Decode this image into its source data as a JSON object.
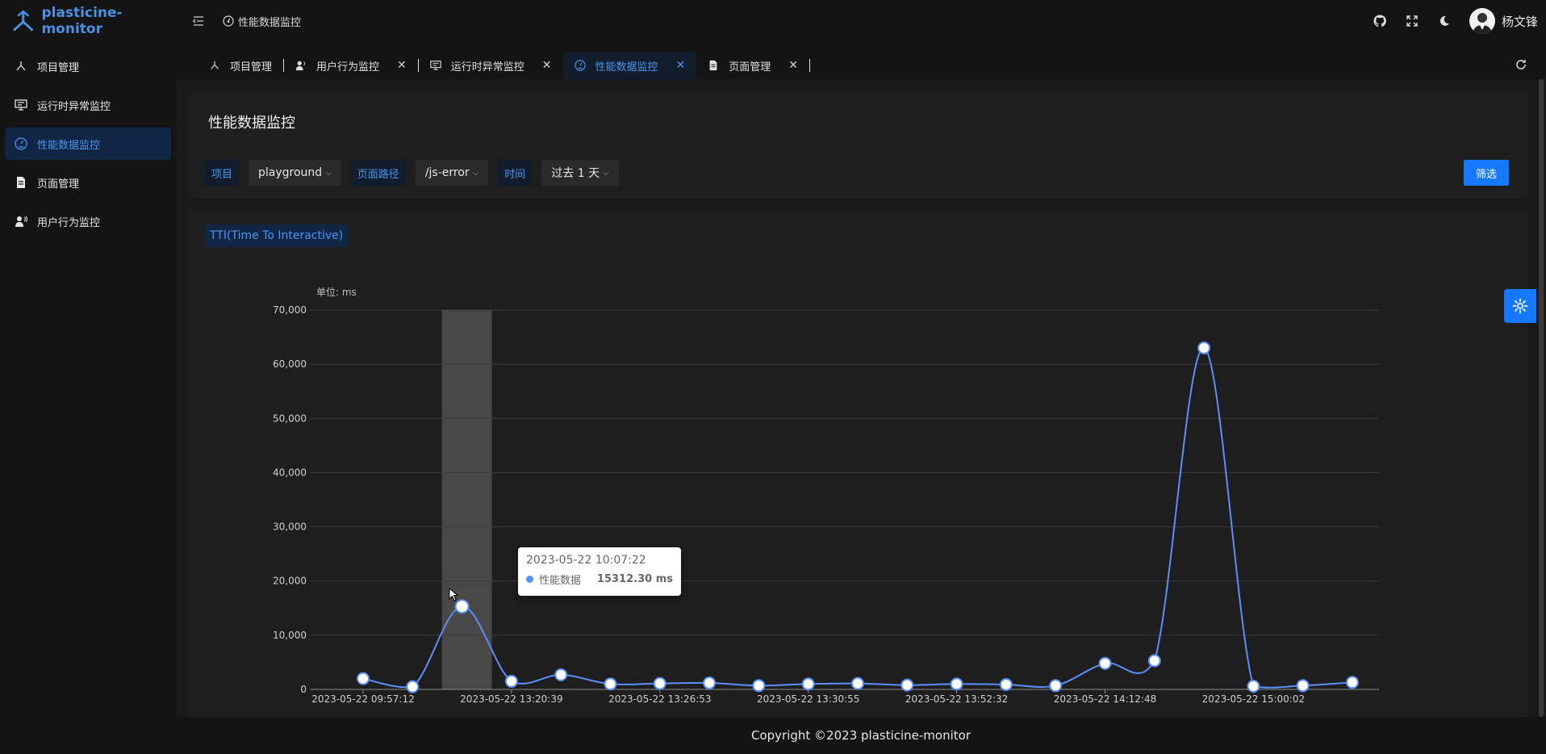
{
  "app": {
    "name": "plasticine-monitor"
  },
  "header": {
    "breadcrumb": "性能数据监控",
    "user_name": "杨文锋",
    "icons": [
      "github-icon",
      "fullscreen-icon",
      "dark-mode-icon"
    ]
  },
  "sidebar": {
    "items": [
      {
        "label": "项目管理",
        "icon": "project-icon",
        "active": false
      },
      {
        "label": "运行时异常监控",
        "icon": "monitor-icon",
        "active": false
      },
      {
        "label": "性能数据监控",
        "icon": "performance-icon",
        "active": true
      },
      {
        "label": "页面管理",
        "icon": "page-icon",
        "active": false
      },
      {
        "label": "用户行为监控",
        "icon": "user-behavior-icon",
        "active": false
      }
    ]
  },
  "tabs": [
    {
      "label": "项目管理",
      "closable": false,
      "active": false
    },
    {
      "label": "用户行为监控",
      "closable": true,
      "active": false
    },
    {
      "label": "运行时异常监控",
      "closable": true,
      "active": false
    },
    {
      "label": "性能数据监控",
      "closable": true,
      "active": true
    },
    {
      "label": "页面管理",
      "closable": true,
      "active": false
    }
  ],
  "filters": {
    "title": "性能数据监控",
    "project_label": "项目",
    "project_value": "playground",
    "path_label": "页面路径",
    "path_value": "/js-error",
    "time_label": "时间",
    "time_value": "过去 1 天",
    "submit": "筛选"
  },
  "metric_tag": "TTI(Time To Interactive)",
  "tooltip": {
    "title": "2023-05-22 10:07:22",
    "series": "性能数据",
    "value": "15312.30 ms"
  },
  "footer": "Copyright ©2023 plasticine-monitor",
  "colors": {
    "accent": "#1677ff",
    "line": "#5b8ff9",
    "active_bg": "#112545"
  },
  "chart_data": {
    "type": "line",
    "unit_label": "单位: ms",
    "ylim": [
      0,
      70000
    ],
    "yticks": [
      0,
      10000,
      20000,
      30000,
      40000,
      50000,
      60000,
      70000
    ],
    "ytick_labels": [
      "0",
      "10,000",
      "20,000",
      "30,000",
      "40,000",
      "50,000",
      "60,000",
      "70,000"
    ],
    "xtick_labels": [
      "2023-05-22 09:57:12",
      "2023-05-22 13:20:39",
      "2023-05-22 13:26:53",
      "2023-05-22 13:30:55",
      "2023-05-22 13:52:32",
      "2023-05-22 14:12:48",
      "2023-05-22 15:00:02"
    ],
    "xtick_index": [
      0,
      3,
      6,
      9,
      12,
      15,
      18
    ],
    "values": [
      2000,
      500,
      15312.3,
      1500,
      2700,
      1000,
      1100,
      1200,
      700,
      1000,
      1100,
      800,
      1000,
      900,
      700,
      4800,
      5300,
      63000,
      600,
      700,
      1300
    ],
    "highlight_index": 2,
    "grid": true
  }
}
